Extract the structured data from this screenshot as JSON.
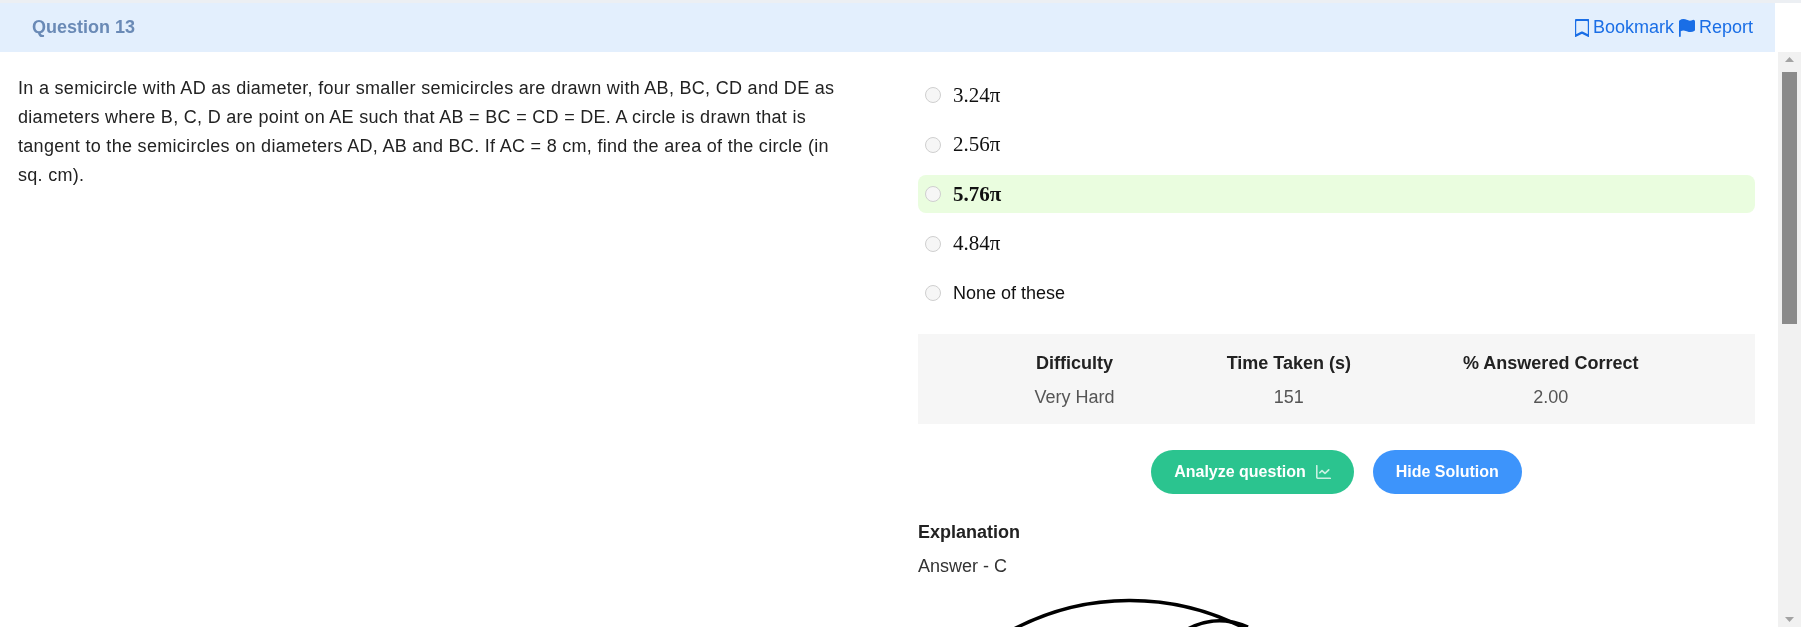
{
  "header": {
    "title": "Question 13",
    "actions": [
      {
        "kind": "bookmark",
        "label": "Bookmark"
      },
      {
        "kind": "report",
        "label": "Report"
      }
    ]
  },
  "question": {
    "text": "In a semicircle with AD as diameter, four smaller semicircles are drawn with AB, BC, CD and DE as diameters where B, C, D are point on AE such that AB = BC = CD = DE. A circle is drawn that is tangent to the semicircles on diameters AD, AB and BC. If AC = 8 cm, find the area of the circle (in sq. cm)."
  },
  "options": [
    {
      "kind": "math",
      "label": "3.24π",
      "selected": false,
      "correct": false
    },
    {
      "kind": "math",
      "label": "2.56π",
      "selected": false,
      "correct": false
    },
    {
      "kind": "math",
      "label": "5.76π",
      "selected": false,
      "correct": true
    },
    {
      "kind": "math",
      "label": "4.84π",
      "selected": false,
      "correct": false
    },
    {
      "kind": "text",
      "label": "None of these",
      "selected": false,
      "correct": false
    }
  ],
  "stats": {
    "columns": [
      {
        "heading": "Difficulty",
        "value": "Very Hard"
      },
      {
        "heading": "Time Taken (s)",
        "value": "151"
      },
      {
        "heading": "% Answered Correct",
        "value": "2.00"
      }
    ]
  },
  "buttons": [
    {
      "kind": "analyze",
      "label": "Analyze question"
    },
    {
      "kind": "toggle_solution",
      "label": "Hide Solution"
    }
  ],
  "explanation": {
    "heading": "Explanation",
    "answer": "Answer - C"
  }
}
